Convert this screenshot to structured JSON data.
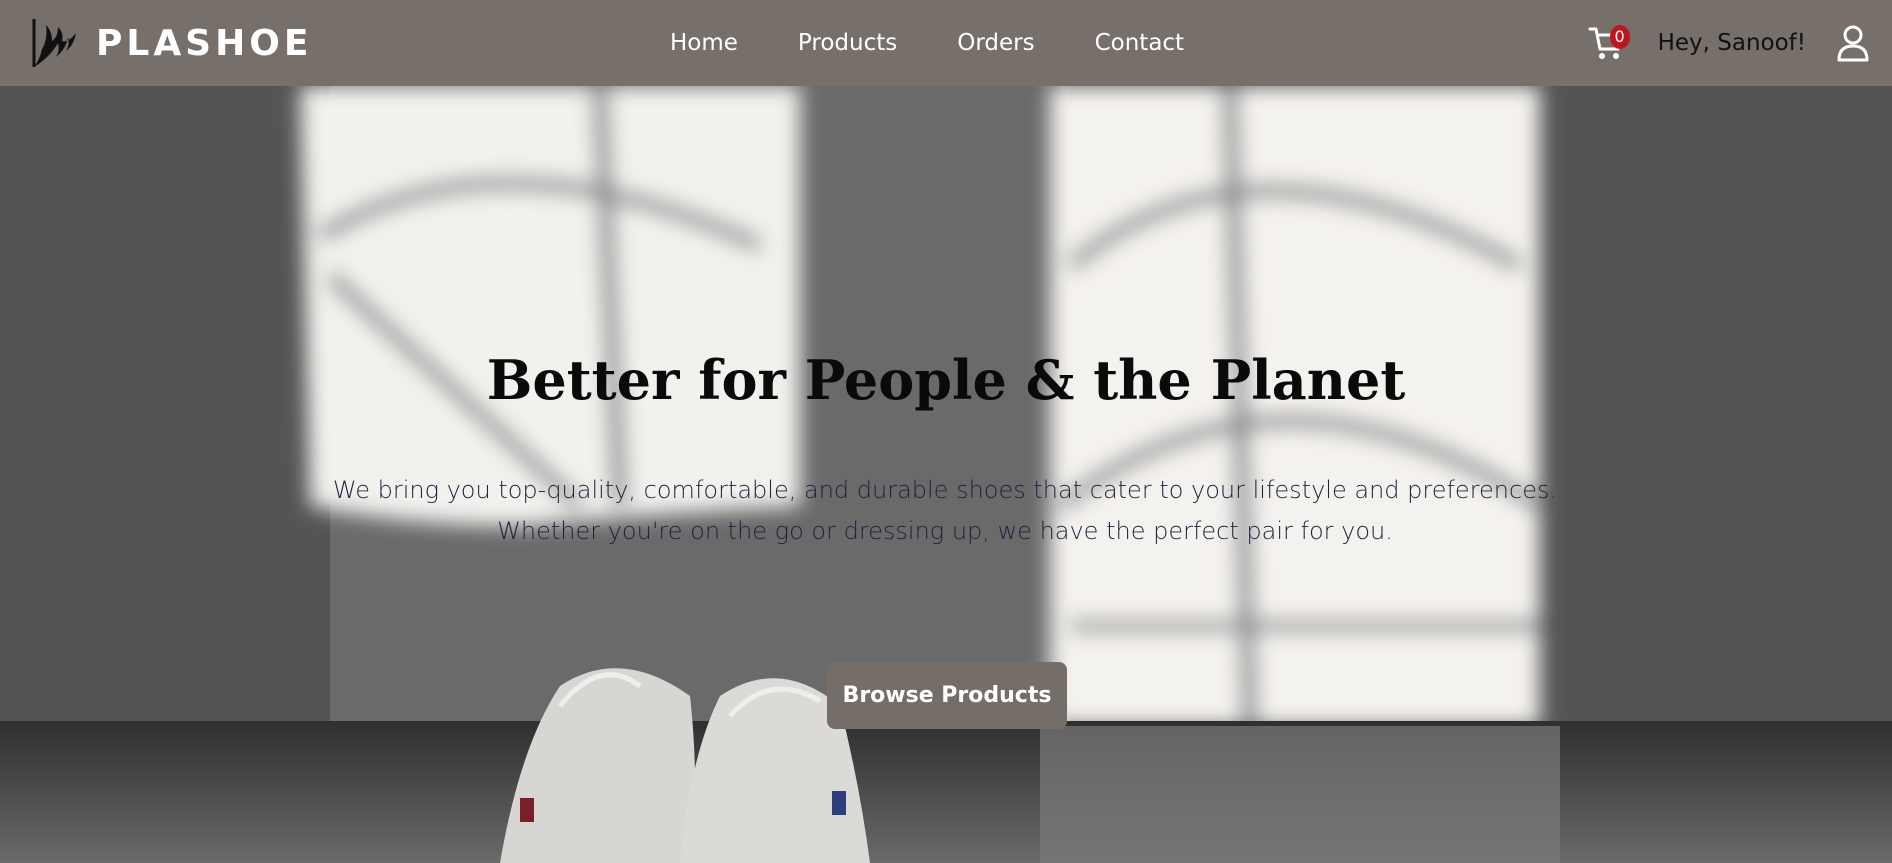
{
  "brand": {
    "name": "PLASHOE",
    "logo_icon": "brand-logo-icon"
  },
  "nav": {
    "links": [
      {
        "label": "Home"
      },
      {
        "label": "Products"
      },
      {
        "label": "Orders"
      },
      {
        "label": "Contact"
      }
    ]
  },
  "header_right": {
    "cart_count": "0",
    "greeting": "Hey, Sanoof!",
    "cart_icon": "cart-icon",
    "user_icon": "user-icon"
  },
  "hero": {
    "title": "Better for People & the Planet",
    "description": "We bring you top-quality, comfortable, and durable shoes that cater to your lifestyle and preferences. Whether you're on the go or dressing up, we have the perfect pair for you.",
    "button_label": "Browse Products"
  },
  "colors": {
    "navbar": "#766f6a",
    "button": "#756e68",
    "badge": "#c0161b"
  }
}
